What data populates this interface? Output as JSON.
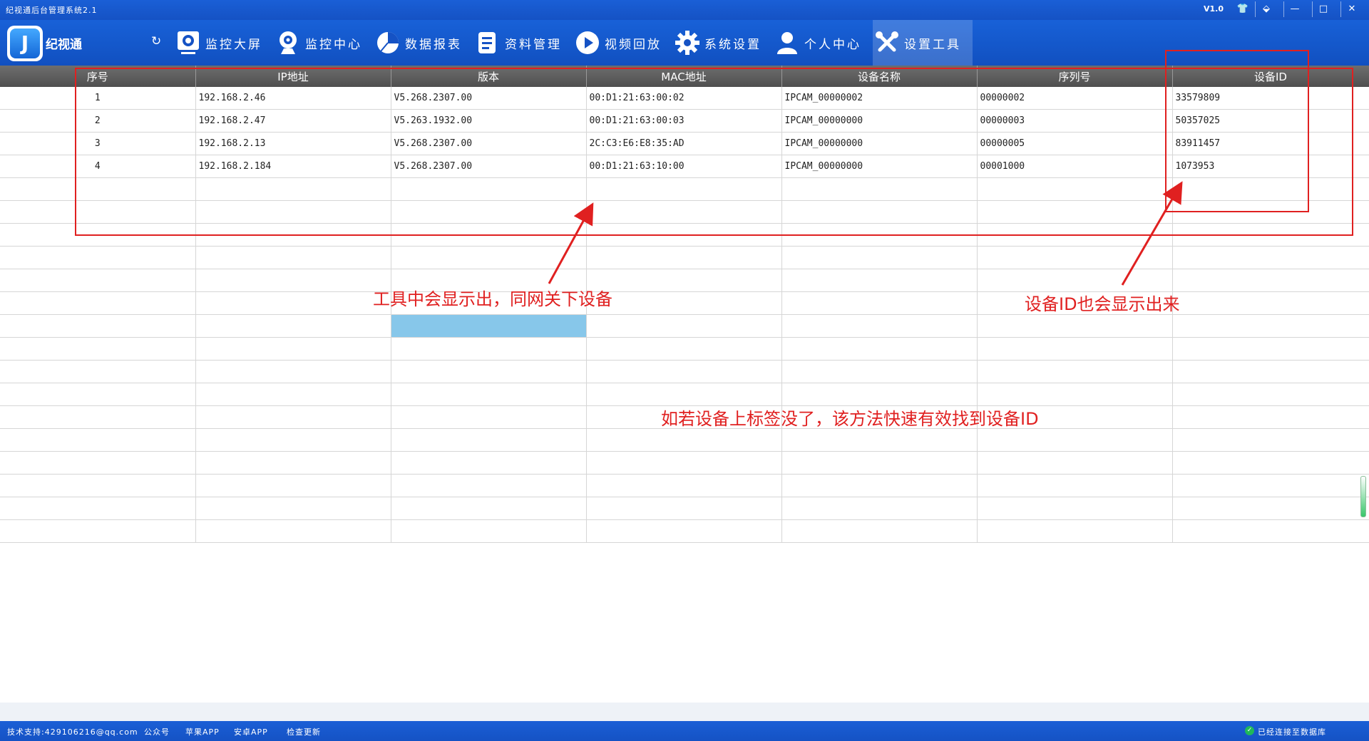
{
  "window": {
    "title": "纪视通后台管理系统2.1",
    "version": "V1.0",
    "controls": [
      "👕",
      "⬙",
      "—",
      "□",
      "✕"
    ]
  },
  "header": {
    "brand": "纪视通",
    "refresh_icon": "↻",
    "nav": [
      {
        "label": "监控大屏",
        "icon": "monitor-icon"
      },
      {
        "label": "监控中心",
        "icon": "webcam-icon"
      },
      {
        "label": "数据报表",
        "icon": "pie-chart-icon"
      },
      {
        "label": "资料管理",
        "icon": "document-icon"
      },
      {
        "label": "视频回放",
        "icon": "play-icon"
      },
      {
        "label": "系统设置",
        "icon": "gear-icon"
      },
      {
        "label": "个人中心",
        "icon": "user-icon"
      },
      {
        "label": "设置工具",
        "icon": "tools-icon",
        "active": true
      }
    ]
  },
  "table": {
    "columns": [
      "序号",
      "IP地址",
      "版本",
      "MAC地址",
      "设备名称",
      "序列号",
      "设备ID"
    ],
    "rows": [
      [
        "1",
        "192.168.2.46",
        "V5.268.2307.00",
        "00:D1:21:63:00:02",
        "IPCAM_00000002",
        "00000002",
        "33579809"
      ],
      [
        "2",
        "192.168.2.47",
        "V5.263.1932.00",
        "00:D1:21:63:00:03",
        "IPCAM_00000000",
        "00000003",
        "50357025"
      ],
      [
        "3",
        "192.168.2.13",
        "V5.268.2307.00",
        "2C:C3:E6:E8:35:AD",
        "IPCAM_00000000",
        "00000005",
        "83911457"
      ],
      [
        "4",
        "192.168.2.184",
        "V5.268.2307.00",
        "00:D1:21:63:10:00",
        "IPCAM_00000000",
        "00001000",
        "1073953"
      ]
    ],
    "empty_rows": 16,
    "selected_cell": {
      "row": 10,
      "col": 2
    }
  },
  "annotations": {
    "network_devices": "工具中会显示出，同网关下设备",
    "device_id": "设备ID也会显示出来",
    "quick_find": "如若设备上标签没了，该方法快速有效找到设备ID",
    "color": "#e02020"
  },
  "statusbar": {
    "support": "技术支持:429106216@qq.com",
    "public_account": "公众号",
    "apple_app": "苹果APP",
    "android_app": "安卓APP",
    "check_update": "检查更新",
    "connection": "已经连接至数据库"
  }
}
